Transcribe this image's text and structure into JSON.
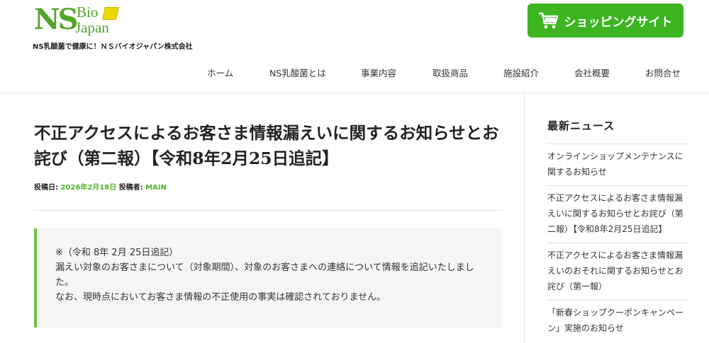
{
  "header": {
    "logo": {
      "ns": "NS",
      "bio": "Bio",
      "japan": "Japan"
    },
    "tagline": "NS乳酸菌で健康に！ＮＳバイオジャパン株式会社",
    "shop_button": {
      "label": "ショッピングサイト",
      "icon": "cart-icon",
      "color": "#3cb521"
    },
    "nav": [
      "ホーム",
      "NS乳酸菌とは",
      "事業内容",
      "取扱商品",
      "施設紹介",
      "会社概要",
      "お問合せ"
    ]
  },
  "article": {
    "title": "不正アクセスによるお客さま情報漏えいに関するお知らせとお詫び（第二報）【令和8年2月25日追記】",
    "meta": {
      "posted_label": "投稿日:",
      "posted_date": "2026年2月18日",
      "author_label": "投稿者:",
      "author": "MAIN"
    },
    "notice": {
      "line1": "※（令和 8年 2月 25日追記）",
      "line2": "漏えい対象のお客さまについて（対象期間）、対象のお客さまへの連絡について情報を追記いたしました。",
      "line3": "なお、現時点においてお客さま情報の不正使用の事実は確認されておりません。"
    }
  },
  "sidebar": {
    "title": "最新ニュース",
    "items": [
      "オンラインショップメンテナンスに関するお知らせ",
      "不正アクセスによるお客さま情報漏えいに関するお知らせとお詫び（第二報）【令和8年2月25日追記】",
      "不正アクセスによるお客さま情報漏えいのおそれに関するお知らせとお詫び（第一報）",
      "「新春ショップクーポンキャンペーン」実施のお知らせ"
    ]
  },
  "colors": {
    "brand_green": "#53a52a",
    "accent_green": "#3cb521",
    "meta_green": "#53b32a"
  }
}
